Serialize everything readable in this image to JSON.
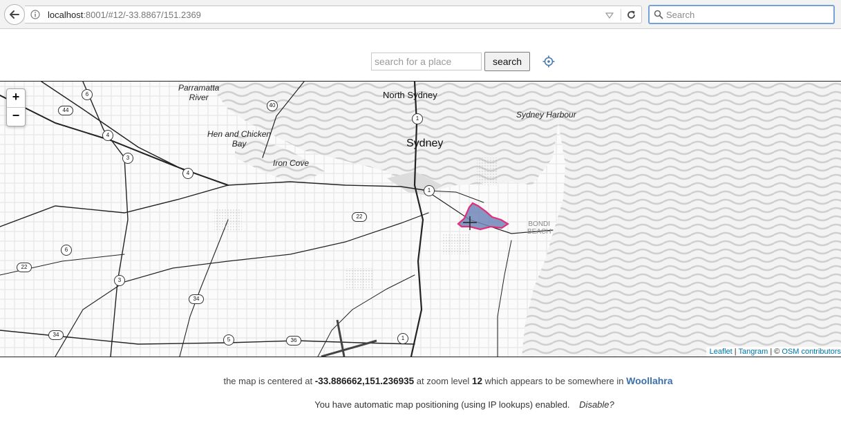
{
  "browser": {
    "url_host": "localhost",
    "url_rest": ":8001/#12/-33.8867/151.2369",
    "search_placeholder": "Search"
  },
  "place_search": {
    "placeholder": "search for a place",
    "button_label": "search"
  },
  "map": {
    "zoom_in": "+",
    "zoom_out": "−",
    "labels": {
      "parramatta_river": "Parramatta\nRiver",
      "north_sydney": "North Sydney",
      "sydney": "Sydney",
      "sydney_harbour": "Sydney Harbour",
      "hen_and_chicken_bay": "Hen and Chicken\nBay",
      "iron_cove": "Iron Cove",
      "bondi_beach": "BONDI\nBEACH"
    },
    "road_shields": [
      "6",
      "40",
      "44",
      "4",
      "3",
      "4",
      "1",
      "1",
      "22",
      "6",
      "22",
      "3",
      "34",
      "5",
      "36",
      "1",
      "34"
    ],
    "attribution": {
      "leaflet": "Leaflet",
      "sep1": " | ",
      "tangram": "Tangram",
      "sep2": " | © ",
      "osm": "OSM contributors"
    },
    "highlight_color": "#e0307a",
    "highlight_fill": "#6f86b8"
  },
  "status": {
    "prefix": "the map is centered at",
    "coords": "-33.886662,151.236935",
    "zoom_text": "at zoom level",
    "zoom": "12",
    "suffix": "which appears to be somewhere in",
    "place": "Woollahra"
  },
  "auto": {
    "message": "You have automatic map positioning (using IP lookups) enabled.",
    "disable_label": "Disable?"
  }
}
